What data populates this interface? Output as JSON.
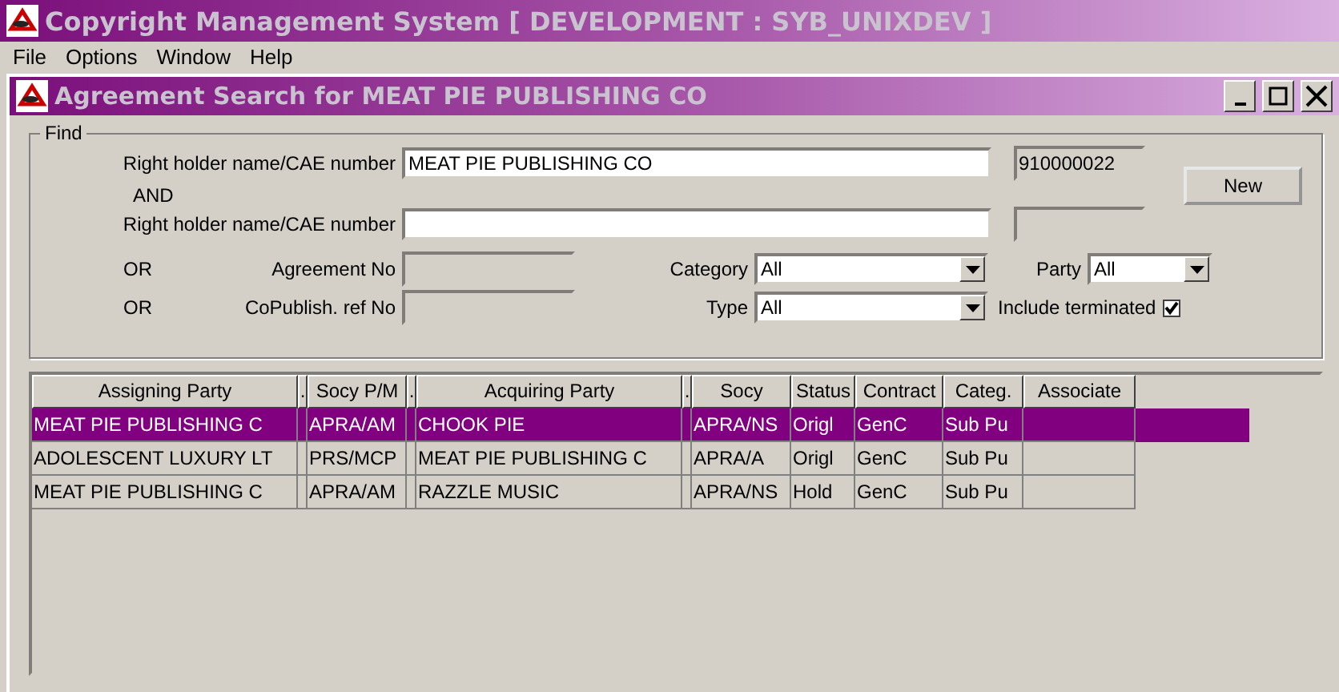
{
  "app_window": {
    "title": "Copyright Management System [ DEVELOPMENT : SYB_UNIXDEV ]"
  },
  "menu": [
    "File",
    "Options",
    "Window",
    "Help"
  ],
  "child_window": {
    "title": "Agreement Search for MEAT PIE PUBLISHING CO"
  },
  "find": {
    "legend": "Find",
    "holder1": {
      "label": "Right holder name/CAE number",
      "value": "MEAT PIE PUBLISHING CO",
      "number": "910000022"
    },
    "and_label": "AND",
    "holder2": {
      "label": "Right holder name/CAE number"
    },
    "or1": "OR",
    "agreement_label": "Agreement No",
    "or2": "OR",
    "copublish_label": "CoPublish. ref No",
    "category": {
      "label": "Category",
      "value": "All"
    },
    "type": {
      "label": "Type",
      "value": "All"
    },
    "party": {
      "label": "Party",
      "value": "All"
    },
    "include_terminated": {
      "label": "Include terminated",
      "checked": true
    },
    "new_button": "New"
  },
  "table": {
    "columns": [
      "Assigning Party",
      ".",
      "Socy P/M",
      ".",
      "Acquiring Party",
      ".",
      "Socy",
      "Status",
      "Contract",
      "Categ.",
      "Associate"
    ],
    "rows": [
      {
        "selected": true,
        "cells": [
          "MEAT PIE PUBLISHING C",
          "",
          "APRA/AM",
          "",
          "CHOOK PIE",
          "",
          "APRA/NS",
          "Origl",
          "GenC",
          "Sub Pu",
          ""
        ]
      },
      {
        "selected": false,
        "cells": [
          "ADOLESCENT LUXURY LT",
          "",
          "PRS/MCP",
          "",
          "MEAT PIE PUBLISHING C",
          "",
          "APRA/A",
          "Origl",
          "GenC",
          "Sub Pu",
          ""
        ]
      },
      {
        "selected": false,
        "cells": [
          "MEAT PIE PUBLISHING C",
          "",
          "APRA/AM",
          "",
          "RAZZLE MUSIC",
          "",
          "APRA/NS",
          "Hold",
          "GenC",
          "Sub Pu",
          ""
        ]
      }
    ]
  }
}
